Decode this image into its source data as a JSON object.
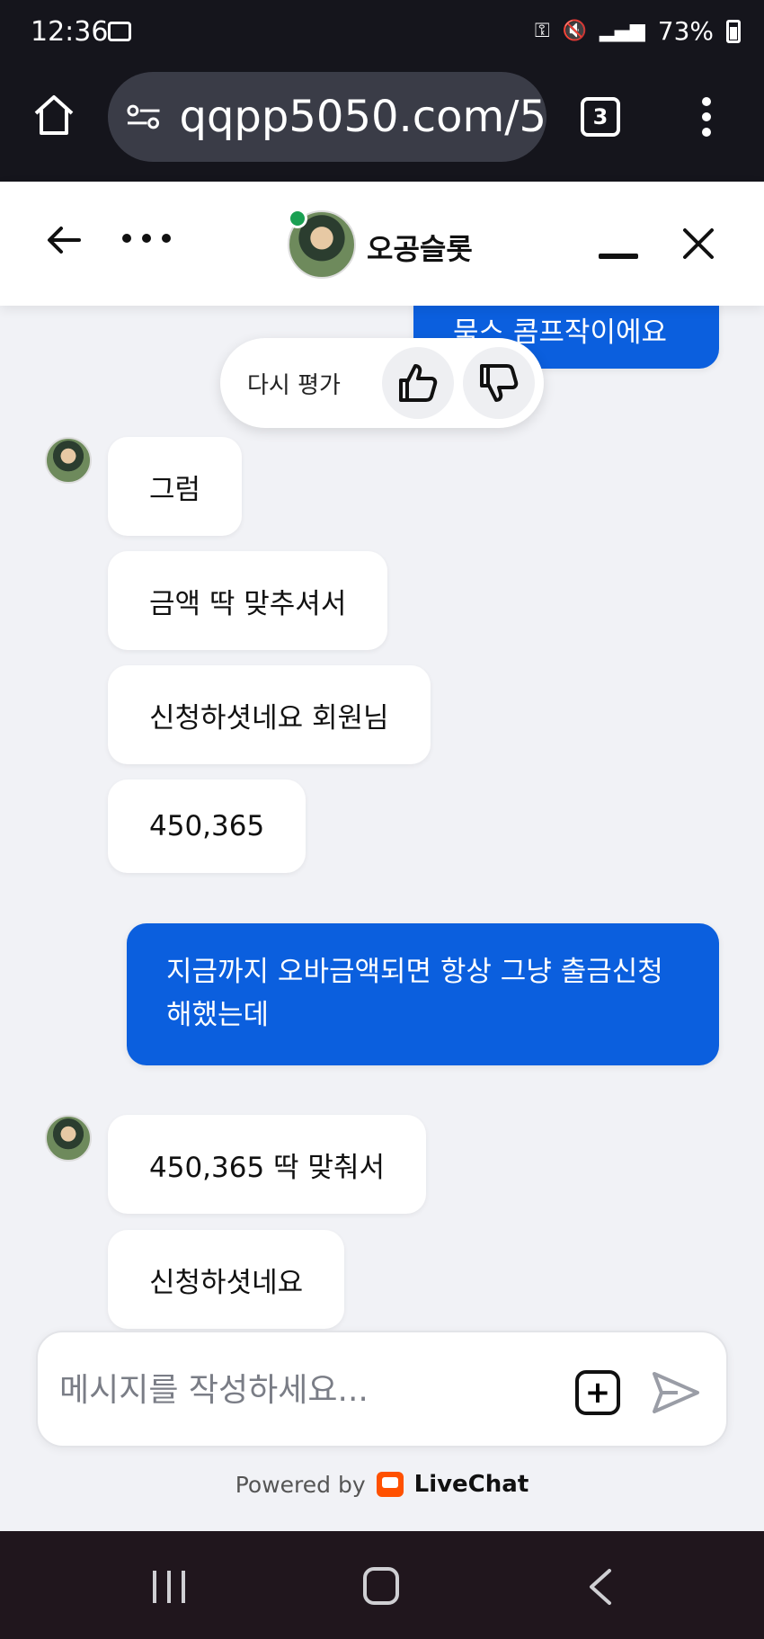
{
  "status_bar": {
    "time": "12:36",
    "battery": "73%"
  },
  "browser": {
    "url": "qqpp5050.com/5",
    "tab_count": "3"
  },
  "chat_header": {
    "agent_name": "오공슬롯"
  },
  "rating": {
    "label": "다시 평가"
  },
  "messages": {
    "out_top": "묵스 콤프작이에요",
    "in_1": "그럼",
    "in_2": "금액 딱 맞추셔서",
    "in_3": "신청하셧네요 회원님",
    "in_4": "450,365",
    "out_1": "지금까지 오바금액되면 항상 그냥 출금신청해했는데",
    "in_5": "450,365 딱 맞춰서",
    "in_6": "신청하셧네요"
  },
  "composer": {
    "placeholder": "메시지를 작성하세요..."
  },
  "footer": {
    "powered_by": "Powered by",
    "brand": "LiveChat"
  },
  "icons": [
    "image-icon",
    "key-icon",
    "mute-icon",
    "home-icon",
    "tune-icon",
    "back-arrow-icon",
    "more-icon",
    "minimize-icon",
    "close-icon",
    "thumbs-up-icon",
    "thumbs-down-icon",
    "add-icon",
    "send-icon",
    "livechat-logo-icon",
    "recent-apps-icon",
    "nav-home-icon",
    "nav-back-icon"
  ]
}
